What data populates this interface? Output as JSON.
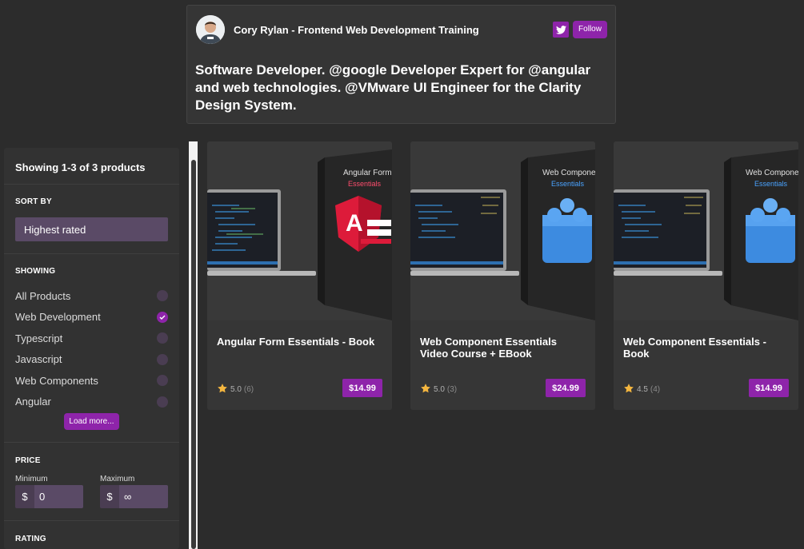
{
  "twitter": {
    "name": "Cory Rylan - Frontend Web Development Training",
    "follow_label": "Follow",
    "bio": "Software Developer. @google Developer Expert for @angular and web technologies. @VMware UI Engineer for the Clarity Design System."
  },
  "sidebar": {
    "summary": "Showing 1-3 of 3 products",
    "sort_title": "SORT BY",
    "sort_value": "Highest rated",
    "showing_title": "SHOWING",
    "categories": [
      {
        "label": "All Products",
        "selected": false
      },
      {
        "label": "Web Development",
        "selected": true
      },
      {
        "label": "Typescript",
        "selected": false
      },
      {
        "label": "Javascript",
        "selected": false
      },
      {
        "label": "Web Components",
        "selected": false
      },
      {
        "label": "Angular",
        "selected": false
      }
    ],
    "load_more_label": "Load more...",
    "price_title": "PRICE",
    "min_label": "Minimum",
    "max_label": "Maximum",
    "currency_symbol": "$",
    "min_value": "0",
    "max_value": "∞",
    "rating_title": "RATING"
  },
  "products": [
    {
      "title": "Angular Form Essentials - Book",
      "rating": "5.0",
      "reviews": "(6)",
      "price": "$14.99",
      "cover_title": "Angular Form",
      "cover_subtitle": "Essentials",
      "cover_icon": "angular-logo-icon"
    },
    {
      "title": "Web Component Essentials Video Course + EBook",
      "rating": "5.0",
      "reviews": "(3)",
      "price": "$24.99",
      "cover_title": "Web Component",
      "cover_subtitle": "Essentials",
      "cover_icon": "lego-block-icon"
    },
    {
      "title": "Web Component Essentials - Book",
      "rating": "4.5",
      "reviews": "(4)",
      "price": "$14.99",
      "cover_title": "Web Component",
      "cover_subtitle": "Essentials",
      "cover_icon": "lego-block-icon"
    }
  ],
  "colors": {
    "accent": "#8e24aa",
    "background": "#2c2c2c",
    "panel": "#323232",
    "star": "#f4b63f"
  }
}
